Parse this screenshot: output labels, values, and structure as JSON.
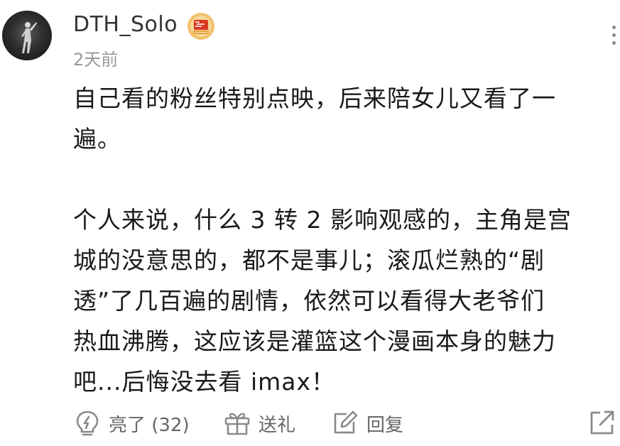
{
  "comment": {
    "author": {
      "username": "DTH_Solo",
      "avatar": "avatar-icon",
      "badge": "verified-badge-icon"
    },
    "timestamp": "2天前",
    "paragraphs": [
      [
        "自己看的粉丝特别点映，后来陪女儿又看了一",
        "遍。"
      ],
      [
        "个人来说，什么 3 转 2 影响观感的，主角是宫",
        "城的没意思的，都不是事儿；滚瓜烂熟的“剧",
        "透”了几百遍的剧情，依然可以看得大老爷们",
        "热血沸腾，这应该是灌篮这个漫画本身的魅力",
        "吧...后悔没去看 imax！"
      ]
    ],
    "actions": {
      "like_label": "亮了 (32)",
      "gift_label": "送礼",
      "reply_label": "回复"
    },
    "icons": {
      "more": "more-vertical-icon",
      "like": "lightbulb-icon",
      "gift": "gift-icon",
      "reply": "edit-reply-icon",
      "share": "share-icon"
    }
  }
}
